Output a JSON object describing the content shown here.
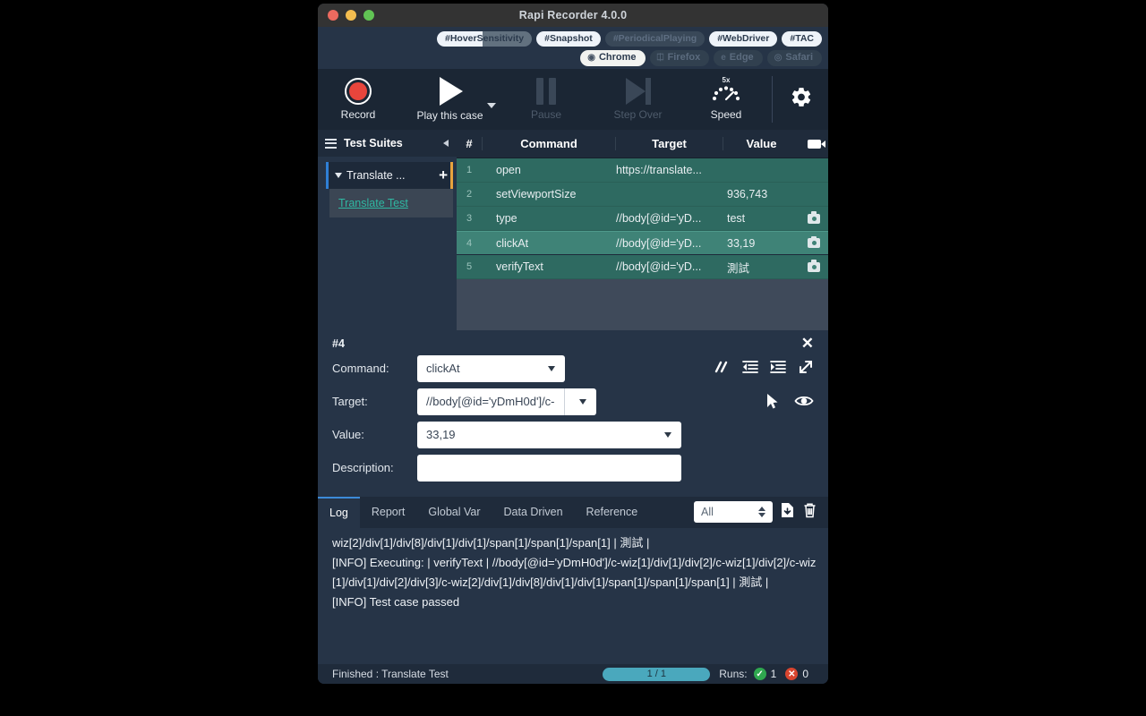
{
  "window": {
    "title": "Rapi Recorder 4.0.0",
    "traffic": [
      "close",
      "minimize",
      "zoom"
    ]
  },
  "tags": {
    "features": [
      {
        "label": "#HoverSensitivity",
        "state": "hover"
      },
      {
        "label": "#Snapshot",
        "state": "on"
      },
      {
        "label": "#PeriodicalPlaying",
        "state": "off"
      },
      {
        "label": "#WebDriver",
        "state": "on"
      },
      {
        "label": "#TAC",
        "state": "on"
      }
    ],
    "browsers": [
      {
        "label": "Chrome",
        "state": "on",
        "icon": "chrome-icon"
      },
      {
        "label": "Firefox",
        "state": "off",
        "icon": "firefox-icon"
      },
      {
        "label": "Edge",
        "state": "off",
        "icon": "edge-icon"
      },
      {
        "label": "Safari",
        "state": "off",
        "icon": "safari-icon"
      }
    ]
  },
  "toolbar": {
    "record": "Record",
    "play": "Play this case",
    "pause": "Pause",
    "step_over": "Step Over",
    "speed": "Speed",
    "speed_value": "5x",
    "settings_icon": "gear-icon"
  },
  "sidebar": {
    "title": "Test Suites",
    "menu_icon": "hamburger-icon",
    "collapse_icon": "chevron-left-icon",
    "suite": {
      "name": "Translate ...",
      "add_label": "+",
      "expanded": true
    },
    "cases": [
      {
        "name": "Translate Test",
        "selected": true
      }
    ]
  },
  "table": {
    "headers": {
      "num": "#",
      "command": "Command",
      "target": "Target",
      "value": "Value",
      "camera": "camera-icon"
    },
    "rows": [
      {
        "num": "1",
        "command": "open",
        "target": "https://translate...",
        "value": "",
        "camera": false,
        "selected": false
      },
      {
        "num": "2",
        "command": "setViewportSize",
        "target": "",
        "value": "936,743",
        "camera": false,
        "selected": false
      },
      {
        "num": "3",
        "command": "type",
        "target": "//body[@id='yD...",
        "value": "test",
        "camera": true,
        "selected": false
      },
      {
        "num": "4",
        "command": "clickAt",
        "target": "//body[@id='yD...",
        "value": "33,19",
        "camera": true,
        "selected": true
      },
      {
        "num": "5",
        "command": "verifyText",
        "target": "//body[@id='yD...",
        "value": "測試",
        "camera": true,
        "selected": false
      }
    ]
  },
  "detail": {
    "index": "#4",
    "close_icon": "close-icon",
    "command_label": "Command:",
    "command_value": "clickAt",
    "target_label": "Target:",
    "target_value": "//body[@id='yDmH0d']/c-",
    "value_label": "Value:",
    "value_value": "33,19",
    "description_label": "Description:",
    "description_value": "",
    "icons": {
      "comment": "comment-slashes-icon",
      "outdent": "outdent-icon",
      "indent": "indent-icon",
      "expand": "expand-icon",
      "select_element": "cursor-select-icon",
      "highlight": "eye-icon"
    }
  },
  "log": {
    "tabs": [
      {
        "label": "Log",
        "active": true
      },
      {
        "label": "Report",
        "active": false
      },
      {
        "label": "Global Var",
        "active": false
      },
      {
        "label": "Data Driven",
        "active": false
      },
      {
        "label": "Reference",
        "active": false
      }
    ],
    "filter_value": "All",
    "download_icon": "download-icon",
    "clear_icon": "trash-icon",
    "lines": [
      "wiz[2]/div[1]/div[8]/div[1]/div[1]/span[1]/span[1]/span[1] | 測試 |",
      "[INFO] Executing: | verifyText | //body[@id='yDmH0d']/c-wiz[1]/div[1]/div[2]/c-wiz[1]/div[2]/c-wiz[1]/div[1]/div[2]/div[3]/c-wiz[2]/div[1]/div[8]/div[1]/div[1]/span[1]/span[1]/span[1] | 測試 |",
      "[INFO] Test case passed"
    ]
  },
  "status": {
    "message": "Finished : Translate Test",
    "progress": "1 / 1",
    "runs_label": "Runs:",
    "passed": "1",
    "failed": "0"
  }
}
